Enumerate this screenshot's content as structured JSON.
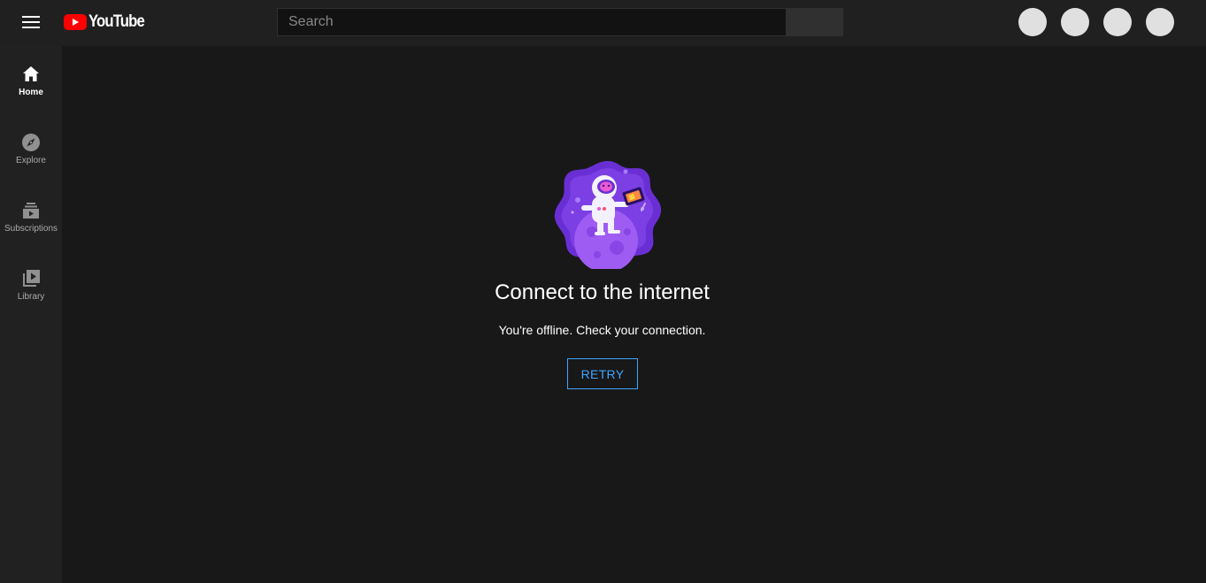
{
  "header": {
    "logo_text": "YouTube",
    "search_placeholder": "Search",
    "avatars": [
      "avatar-1",
      "avatar-2",
      "avatar-3",
      "avatar-4"
    ]
  },
  "sidebar": {
    "items": [
      {
        "label": "Home",
        "icon": "home-icon",
        "active": true
      },
      {
        "label": "Explore",
        "icon": "compass-icon",
        "active": false
      },
      {
        "label": "Subscriptions",
        "icon": "subscriptions-icon",
        "active": false
      },
      {
        "label": "Library",
        "icon": "library-icon",
        "active": false
      }
    ]
  },
  "offline": {
    "title": "Connect to the internet",
    "message": "You're offline. Check your connection.",
    "retry_label": "RETRY"
  },
  "colors": {
    "background": "#181818",
    "topbar": "#202020",
    "sidebar": "#212121",
    "accent_blue": "#3ea6ff",
    "youtube_red": "#ff0000",
    "illustration_purple": "#7b3fe4"
  }
}
